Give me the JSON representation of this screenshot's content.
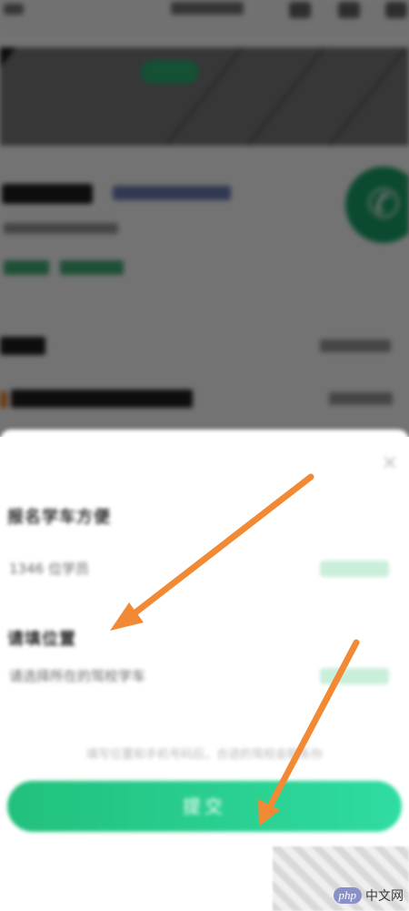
{
  "call_icon": "phone-icon",
  "sheet": {
    "close_icon": "close-icon",
    "section1": {
      "title": "报名学车方便",
      "value": "1346 位学员"
    },
    "section2": {
      "title": "请填位置",
      "value": "请选择所在的驾校学车"
    },
    "hint": "填写位置和手机号码后，合适的驾校会联系你",
    "submit_label": "提交"
  },
  "watermark": {
    "badge": "php",
    "site": "中文网"
  },
  "colors": {
    "accent": "#2fb374",
    "arrow": "#f28a35",
    "submit_start": "#22c07c",
    "submit_end": "#2fdca1"
  }
}
